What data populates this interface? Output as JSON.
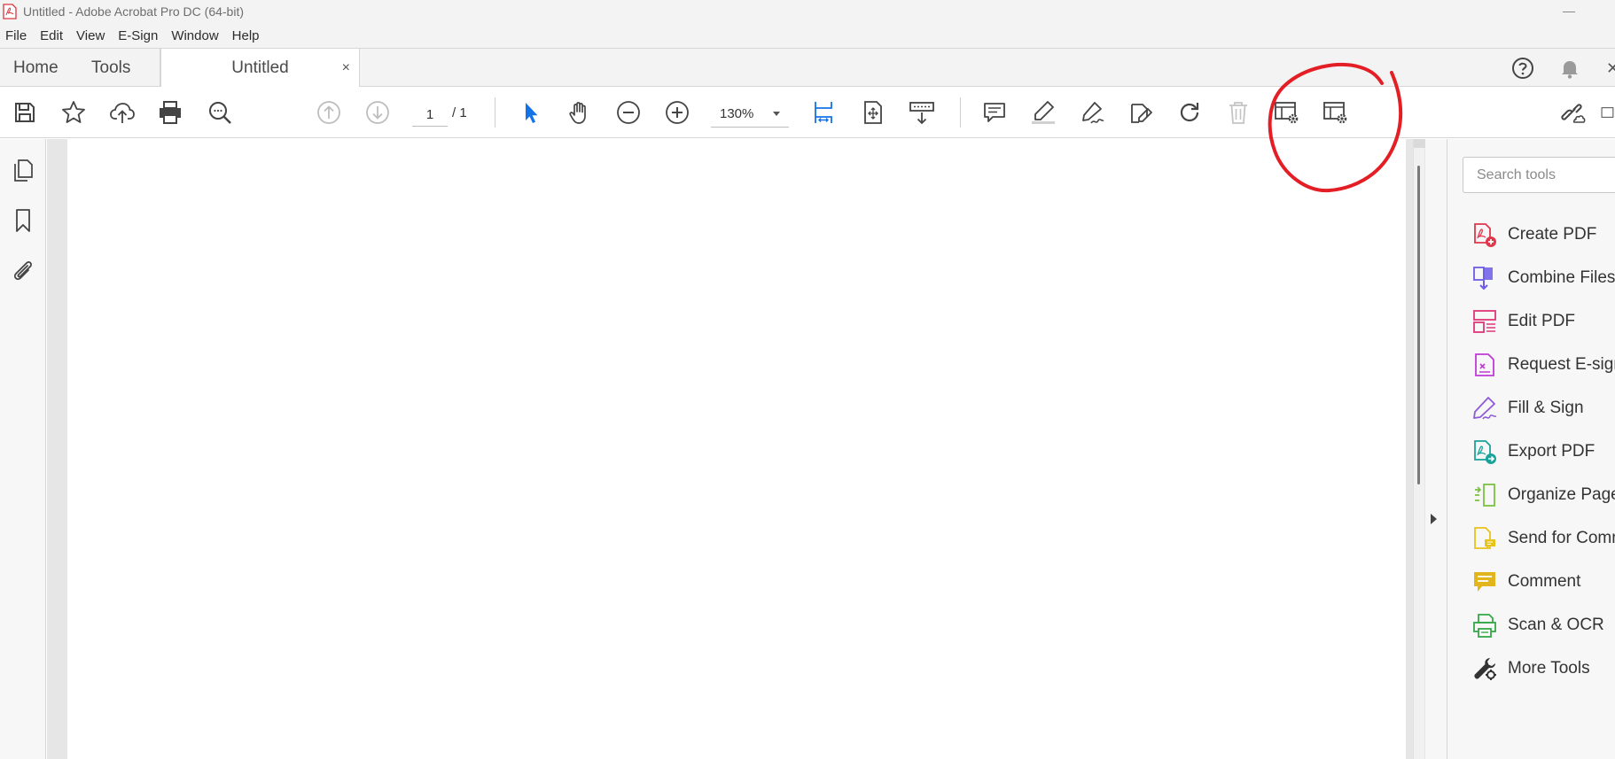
{
  "window": {
    "title": "Untitled - Adobe Acrobat Pro DC (64-bit)"
  },
  "menu": [
    "File",
    "Edit",
    "View",
    "E-Sign",
    "Window",
    "Help"
  ],
  "tabs": {
    "home": "Home",
    "tools": "Tools",
    "document": "Untitled",
    "close_glyph": "×"
  },
  "toolbar": {
    "page_current": "1",
    "page_total": "/  1",
    "zoom": "130%"
  },
  "tools_pane": {
    "search_placeholder": "Search tools",
    "items": [
      {
        "label": "Create PDF",
        "color": "#e0374d"
      },
      {
        "label": "Combine Files",
        "color": "#6c5ce7"
      },
      {
        "label": "Edit PDF",
        "color": "#e0377a"
      },
      {
        "label": "Request E-signatures",
        "color": "#c03ad6"
      },
      {
        "label": "Fill & Sign",
        "color": "#8e5bd6"
      },
      {
        "label": "Export PDF",
        "color": "#1aa39a"
      },
      {
        "label": "Organize Pages",
        "color": "#7bc043"
      },
      {
        "label": "Send for Comments",
        "color": "#e9c21b"
      },
      {
        "label": "Comment",
        "color": "#e2b51c"
      },
      {
        "label": "Scan & OCR",
        "color": "#35a84a"
      },
      {
        "label": "More Tools",
        "color": "#333333"
      }
    ]
  },
  "colors": {
    "accent_blue": "#1473e6",
    "annotation_red": "#e31e24",
    "acrobat_red": "#d7373f"
  }
}
